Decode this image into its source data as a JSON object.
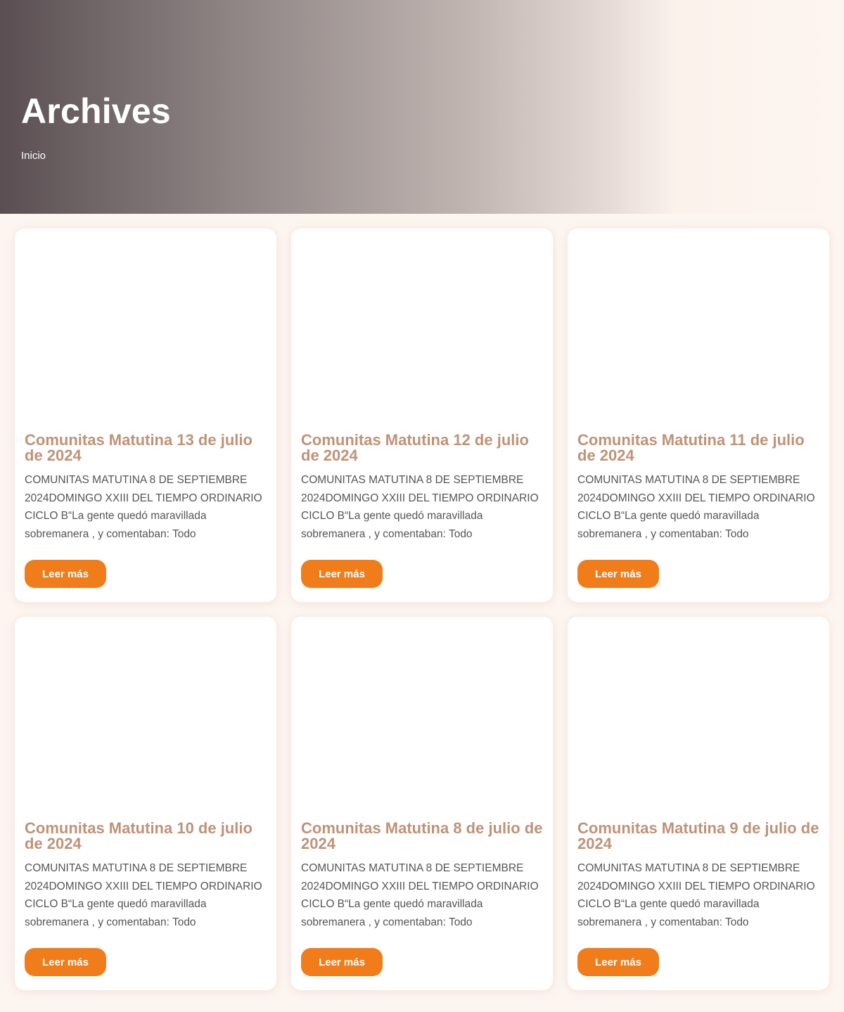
{
  "header": {
    "title": "Archives",
    "breadcrumb": "Inicio"
  },
  "colors": {
    "accent": "#f07c1a",
    "title": "#c09276",
    "background": "#fdf5f0"
  },
  "posts": [
    {
      "title": "Comunitas Matutina 13 de julio de 2024",
      "excerpt": "COMUNITAS MATUTINA 8 DE SEPTIEMBRE 2024DOMINGO XXIII DEL TIEMPO ORDINARIO CICLO B“La gente quedó maravillada sobremanera , y comentaban: Todo",
      "button": "Leer más"
    },
    {
      "title": "Comunitas Matutina 12 de julio de 2024",
      "excerpt": "COMUNITAS MATUTINA 8 DE SEPTIEMBRE 2024DOMINGO XXIII DEL TIEMPO ORDINARIO CICLO B“La gente quedó maravillada sobremanera , y comentaban: Todo",
      "button": "Leer más"
    },
    {
      "title": "Comunitas Matutina 11 de julio de 2024",
      "excerpt": "COMUNITAS MATUTINA 8 DE SEPTIEMBRE 2024DOMINGO XXIII DEL TIEMPO ORDINARIO CICLO B“La gente quedó maravillada sobremanera , y comentaban: Todo",
      "button": "Leer más"
    },
    {
      "title": "Comunitas Matutina 10 de julio de 2024",
      "excerpt": "COMUNITAS MATUTINA 8 DE SEPTIEMBRE 2024DOMINGO XXIII DEL TIEMPO ORDINARIO CICLO B“La gente quedó maravillada sobremanera , y comentaban: Todo",
      "button": "Leer más"
    },
    {
      "title": "Comunitas Matutina 8 de julio de 2024",
      "excerpt": "COMUNITAS MATUTINA 8 DE SEPTIEMBRE 2024DOMINGO XXIII DEL TIEMPO ORDINARIO CICLO B“La gente quedó maravillada sobremanera , y comentaban: Todo",
      "button": "Leer más"
    },
    {
      "title": "Comunitas Matutina 9 de julio de 2024",
      "excerpt": "COMUNITAS MATUTINA 8 DE SEPTIEMBRE 2024DOMINGO XXIII DEL TIEMPO ORDINARIO CICLO B“La gente quedó maravillada sobremanera , y comentaban: Todo",
      "button": "Leer más"
    }
  ]
}
